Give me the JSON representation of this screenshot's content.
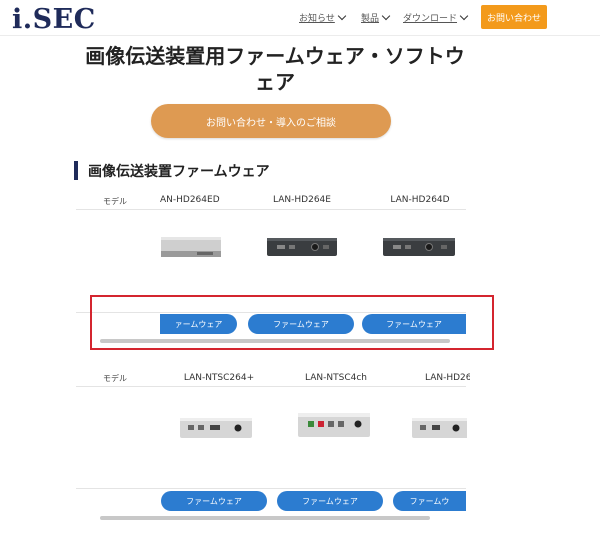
{
  "header": {
    "logo": "i.SEC",
    "nav": [
      {
        "label": "お知らせ"
      },
      {
        "label": "製品"
      },
      {
        "label": "ダウンロード"
      }
    ],
    "contact_button": "お問い合わせ"
  },
  "page": {
    "title": "画像伝送装置用ファームウェア・ソフトウェア",
    "consult_button": "お問い合わせ・導入のご相談",
    "section_title": "画像伝送装置ファームウェア"
  },
  "tables": [
    {
      "model_label": "モデル",
      "models": [
        "AN-HD264ED",
        "LAN-HD264E",
        "LAN-HD264D"
      ],
      "button_label": "ファームウェア",
      "button_labels": [
        "ァームウェア",
        "ファームウェア",
        "ファームウェア"
      ]
    },
    {
      "model_label": "モデル",
      "models": [
        "LAN-NTSC264+",
        "LAN-NTSC4ch",
        "LAN-HD26"
      ],
      "button_label": "ファームウェア",
      "button_labels": [
        "ファームウェア",
        "ファームウェア",
        "ファームウ"
      ]
    }
  ],
  "colors": {
    "logo": "#1f2b5a",
    "header_cta": "#f39a1b",
    "consult_button": "#de9a52",
    "firmware_button": "#2c7cd0",
    "highlight": "#d4252f"
  }
}
